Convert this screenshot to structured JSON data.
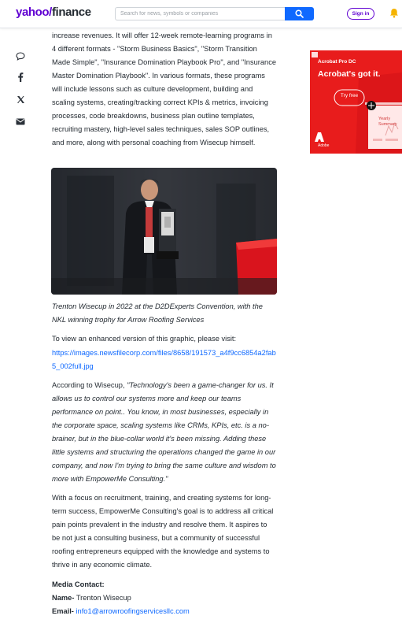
{
  "header": {
    "logo_yahoo": "yahoo/",
    "logo_finance": "finance",
    "search_placeholder": "Search for news, symbols or companies",
    "signin_label": "Sign in"
  },
  "share_icons": [
    "comment-icon",
    "facebook-icon",
    "x-icon",
    "mail-icon"
  ],
  "article": {
    "intro": "increase revenues. It will offer 12-week remote-learning programs in 4 different formats - \"Storm Business Basics\", \"Storm Transition Made Simple\", \"Insurance Domination Playbook Pro\", and \"Insurance Master Domination Playbook\". In various formats, these programs will include lessons such as culture development, building and scaling systems, creating/tracking correct KPIs & metrics, invoicing processes, code breakdowns, business plan outline templates, recruiting mastery, high-level sales techniques, sales SOP outlines, and more, along with personal coaching from Wisecup himself.",
    "caption": "Trenton Wisecup in 2022 at the D2DExperts Convention, with the NKL winning trophy for Arrow Roofing Services",
    "view_text": "To view an enhanced version of this graphic, please visit:",
    "view_link": "https://images.newsfilecorp.com/files/8658/191573_a4f9cc6854a2fab5_002full.jpg",
    "quote_lead": "According to Wisecup, ",
    "quote": "\"Technology's been a game-changer for us. It allows us to control our systems more and keep our teams performance on point.. You know, in most businesses, especially in the corporate space, scaling systems like CRMs, KPIs, etc. is a no-brainer, but in the blue-collar world it's been missing. Adding these little systems and structuring the operations changed the game in our company, and now I'm trying to bring the same culture and wisdom to more with EmpowerMe Consulting.\"",
    "focus": "With a focus on recruitment, training, and creating systems for long-term success, EmpowerMe Consulting's goal is to address all critical pain points prevalent in the industry and resolve them. It aspires to be not just a consulting business, but a community of successful roofing entrepreneurs equipped with the knowledge and systems to thrive in any economic climate.",
    "media_contact": "Media Contact:",
    "name_label": "Name-",
    "name_value": " Trenton Wisecup",
    "email_label": "Email-",
    "email_value": " info1@arrowroofingservicesllc.com"
  },
  "ad": {
    "product": "Acrobat Pro DC",
    "headline": "Acrobat's got it.",
    "cta": "Try free",
    "brand": "Adobe",
    "doc_title": "Yearly Summary",
    "choice_label": "AdChoices"
  },
  "colors": {
    "brand": "#6001d2",
    "link": "#0f69ff",
    "ad_red": "#e81c1c"
  }
}
